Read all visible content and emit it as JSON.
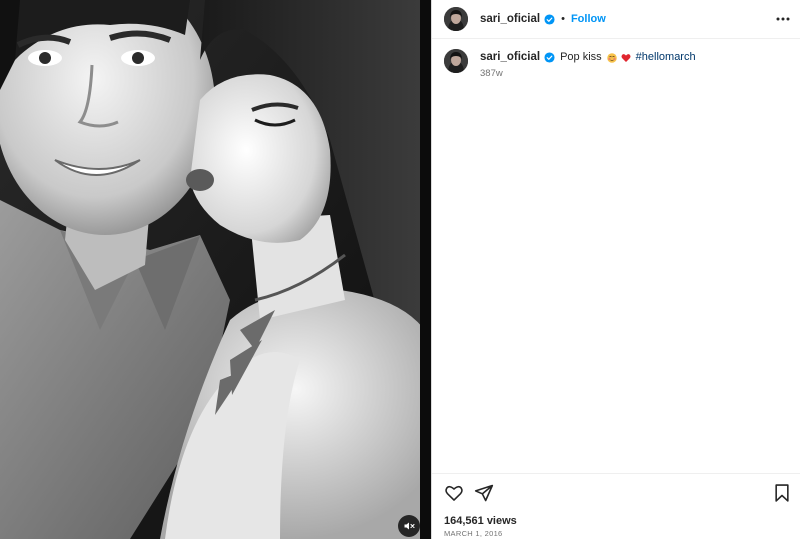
{
  "post": {
    "username": "sari_oficial",
    "verified": true,
    "follow_label": "Follow",
    "separator": "•",
    "caption": {
      "text": "Pop kiss",
      "emojis": [
        "blushing-face-emoji",
        "red-heart-emoji"
      ],
      "hashtag": "#hellomarch"
    },
    "time_ago": "387w",
    "views": "164,561 views",
    "date": "MARCH 1, 2016"
  },
  "media": {
    "type": "video",
    "style": "black-and-white photo",
    "audio_button": "speaker-muted-icon"
  },
  "icons": {
    "more": "more-options-icon",
    "like": "heart-icon",
    "share": "share-icon",
    "save": "bookmark-icon",
    "verified": "verified-badge-icon"
  },
  "colors": {
    "follow": "#0095f6",
    "hashtag": "#00376b",
    "verified": "#0095f6",
    "muted_text": "#737373",
    "divider": "#dbdbdb"
  }
}
